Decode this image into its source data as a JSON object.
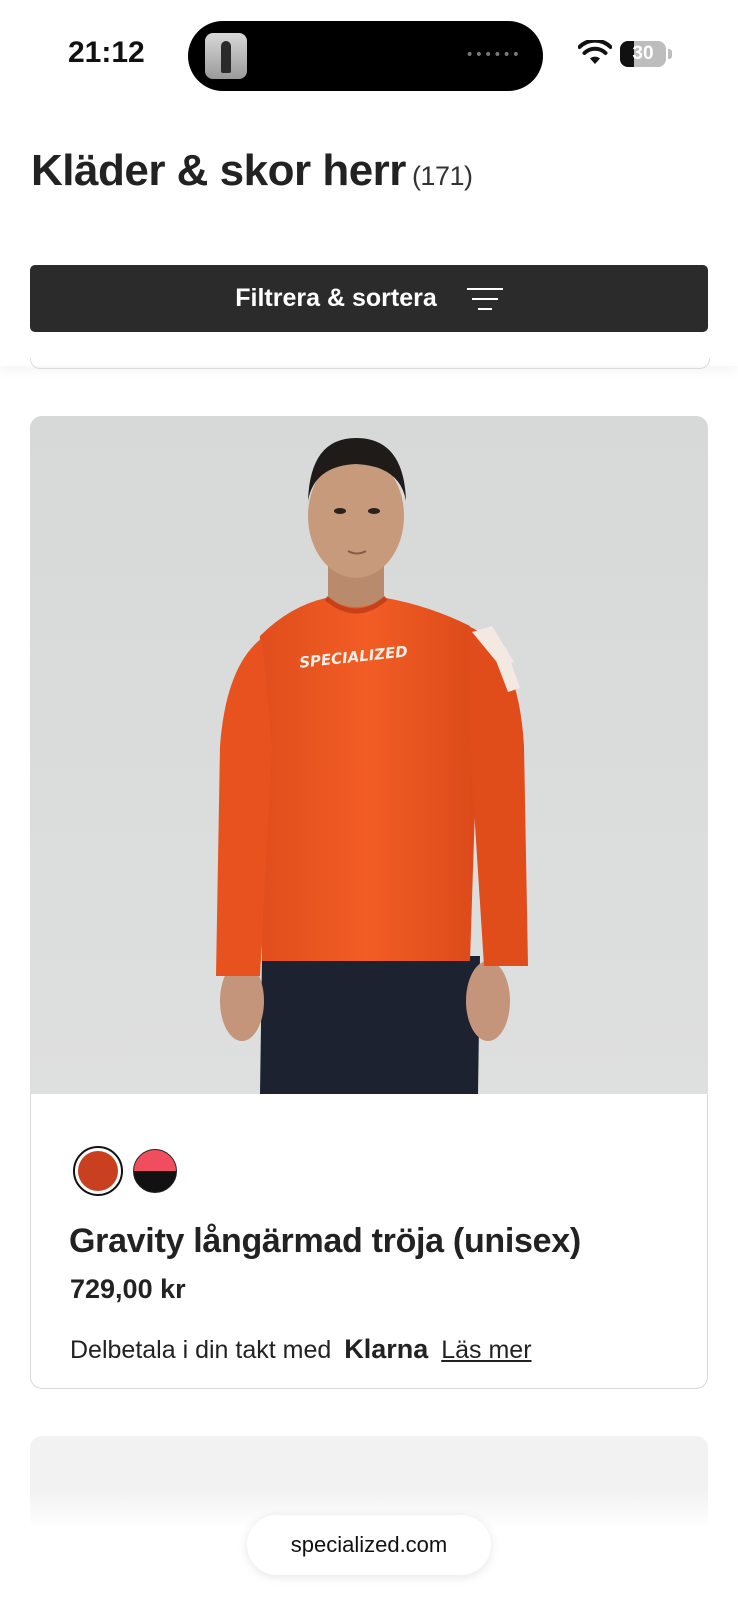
{
  "status_bar": {
    "time": "21:12",
    "battery_level": "30",
    "battery_fraction": 0.3,
    "icons": [
      "wifi-icon",
      "battery-icon"
    ]
  },
  "header": {
    "title": "Kläder & skor herr",
    "count": "(171)",
    "filter_label": "Filtrera & sortera",
    "filter_icon": "filter-lines-icon"
  },
  "product": {
    "name": "Gravity långärmad tröja (unisex)",
    "price": "729,00 kr",
    "image_brand_text": "SPECIALIZED",
    "colors": [
      {
        "name": "orange",
        "hex": "#c8401f",
        "selected": true
      },
      {
        "name": "pink-black",
        "top": "#f04e5e",
        "bottom": "#111111",
        "selected": false
      }
    ],
    "klarna": {
      "prefix": "Delbetala i din takt med",
      "brand": "Klarna",
      "link": "Läs mer"
    }
  },
  "browser": {
    "url": "specialized.com"
  },
  "theme": {
    "button_bg": "#2b2b2c",
    "image_bg": "#dcdddd",
    "shirt": "#f05a22"
  }
}
